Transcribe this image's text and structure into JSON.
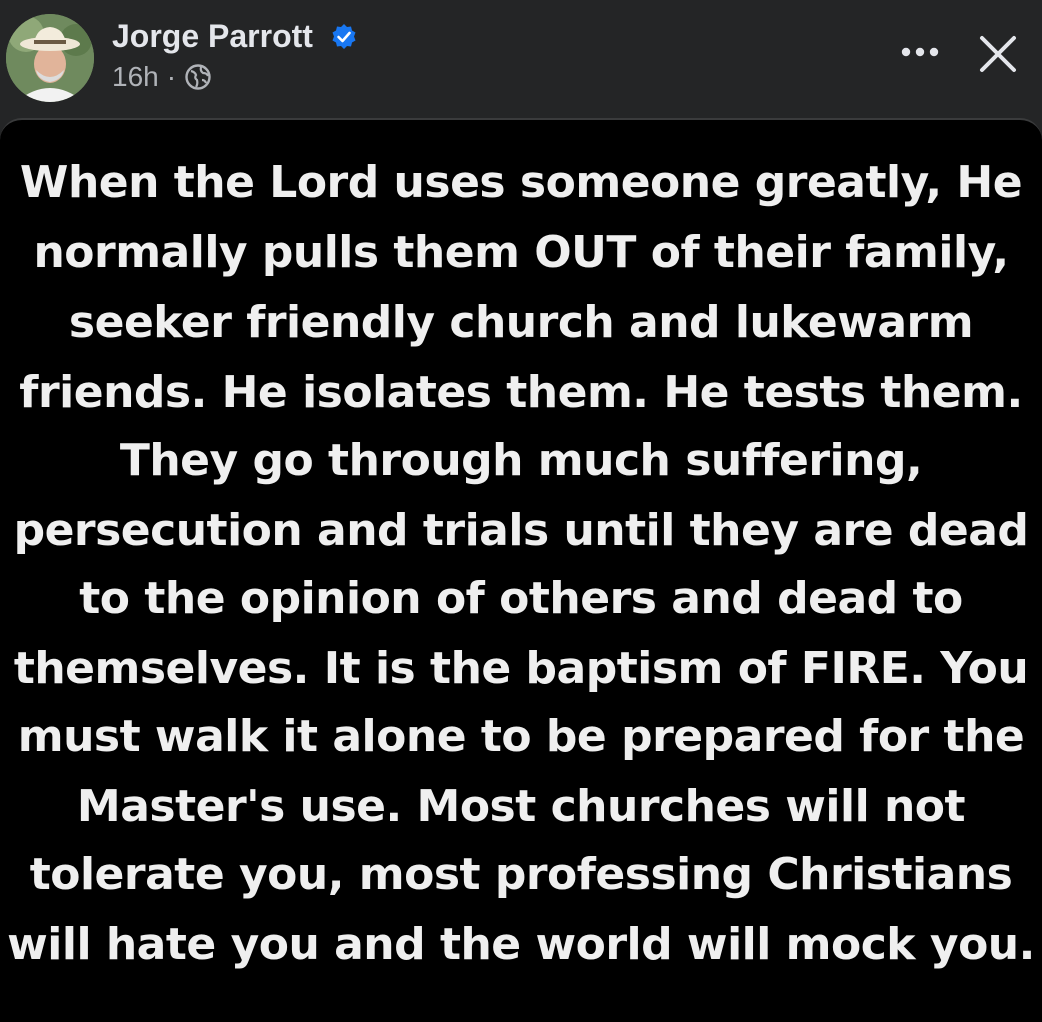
{
  "post": {
    "author_name": "Jorge Parrott",
    "verified": true,
    "timestamp": "16h",
    "separator": "·",
    "privacy_icon": "globe-icon",
    "more_icon": "more-horizontal-icon",
    "close_icon": "close-icon"
  },
  "image_text": {
    "lines": [
      "When the Lord uses someone greatly, He",
      "normally pulls them OUT of their family,",
      "seeker friendly church and lukewarm",
      "friends. He isolates them. He tests them.",
      "They go through much suffering,",
      "persecution and trials until they are dead",
      "to the opinion of others and dead to",
      "themselves. It is the baptism of FIRE. You",
      "must walk it alone to be prepared for the",
      "Master's use. Most churches will not",
      "tolerate you, most professing Christians",
      "will hate you and the world will mock you."
    ]
  },
  "colors": {
    "background": "#242526",
    "verified_badge": "#1877f2",
    "secondary_text": "#b0b3b8",
    "image_background": "#000000",
    "image_text": "#efefef"
  }
}
